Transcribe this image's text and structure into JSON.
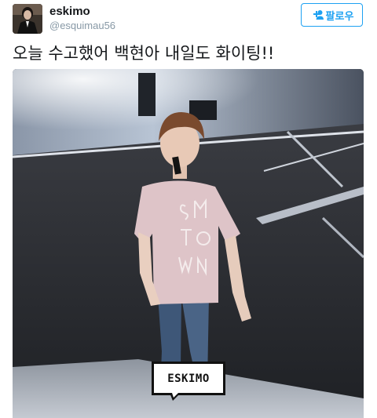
{
  "author": {
    "name": "eskimo",
    "handle": "@esquimau56"
  },
  "follow_button": {
    "label": "팔로우",
    "icon": "person-plus-icon"
  },
  "tweet": {
    "text": "오늘 수고했어 백현아 내일도 화이팅!!"
  },
  "media": {
    "watermark_text": "ESKIMO"
  },
  "colors": {
    "accent": "#1da1f2",
    "handle_gray": "#8899a6",
    "text": "#14171a"
  }
}
